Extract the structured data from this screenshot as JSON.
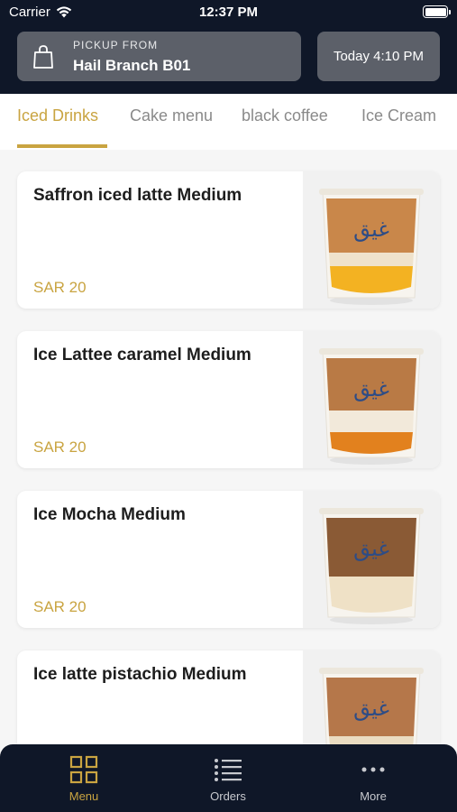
{
  "status_bar": {
    "carrier": "Carrier",
    "time": "12:37 PM"
  },
  "header": {
    "pickup_label": "PICKUP FROM",
    "branch": "Hail Branch B01",
    "pickup_time": "Today 4:10 PM"
  },
  "tabs": [
    {
      "label": "Iced Drinks",
      "active": true
    },
    {
      "label": "Cake menu",
      "active": false
    },
    {
      "label": "black coffee",
      "active": false
    },
    {
      "label": "Ice Cream",
      "active": false
    }
  ],
  "products": [
    {
      "name": "Saffron iced latte Medium",
      "price": "SAR 20"
    },
    {
      "name": "Ice Lattee caramel Medium",
      "price": "SAR 20"
    },
    {
      "name": "Ice Mocha Medium",
      "price": "SAR 20"
    },
    {
      "name": "Ice latte pistachio Medium",
      "price": ""
    }
  ],
  "bottom_nav": [
    {
      "label": "Menu",
      "icon": "grid-icon",
      "active": true
    },
    {
      "label": "Orders",
      "icon": "list-icon",
      "active": false
    },
    {
      "label": "More",
      "icon": "more-icon",
      "active": false
    }
  ],
  "colors": {
    "accent": "#c9a441",
    "header_bg": "#0f1728",
    "pill_bg": "#5c6069"
  }
}
